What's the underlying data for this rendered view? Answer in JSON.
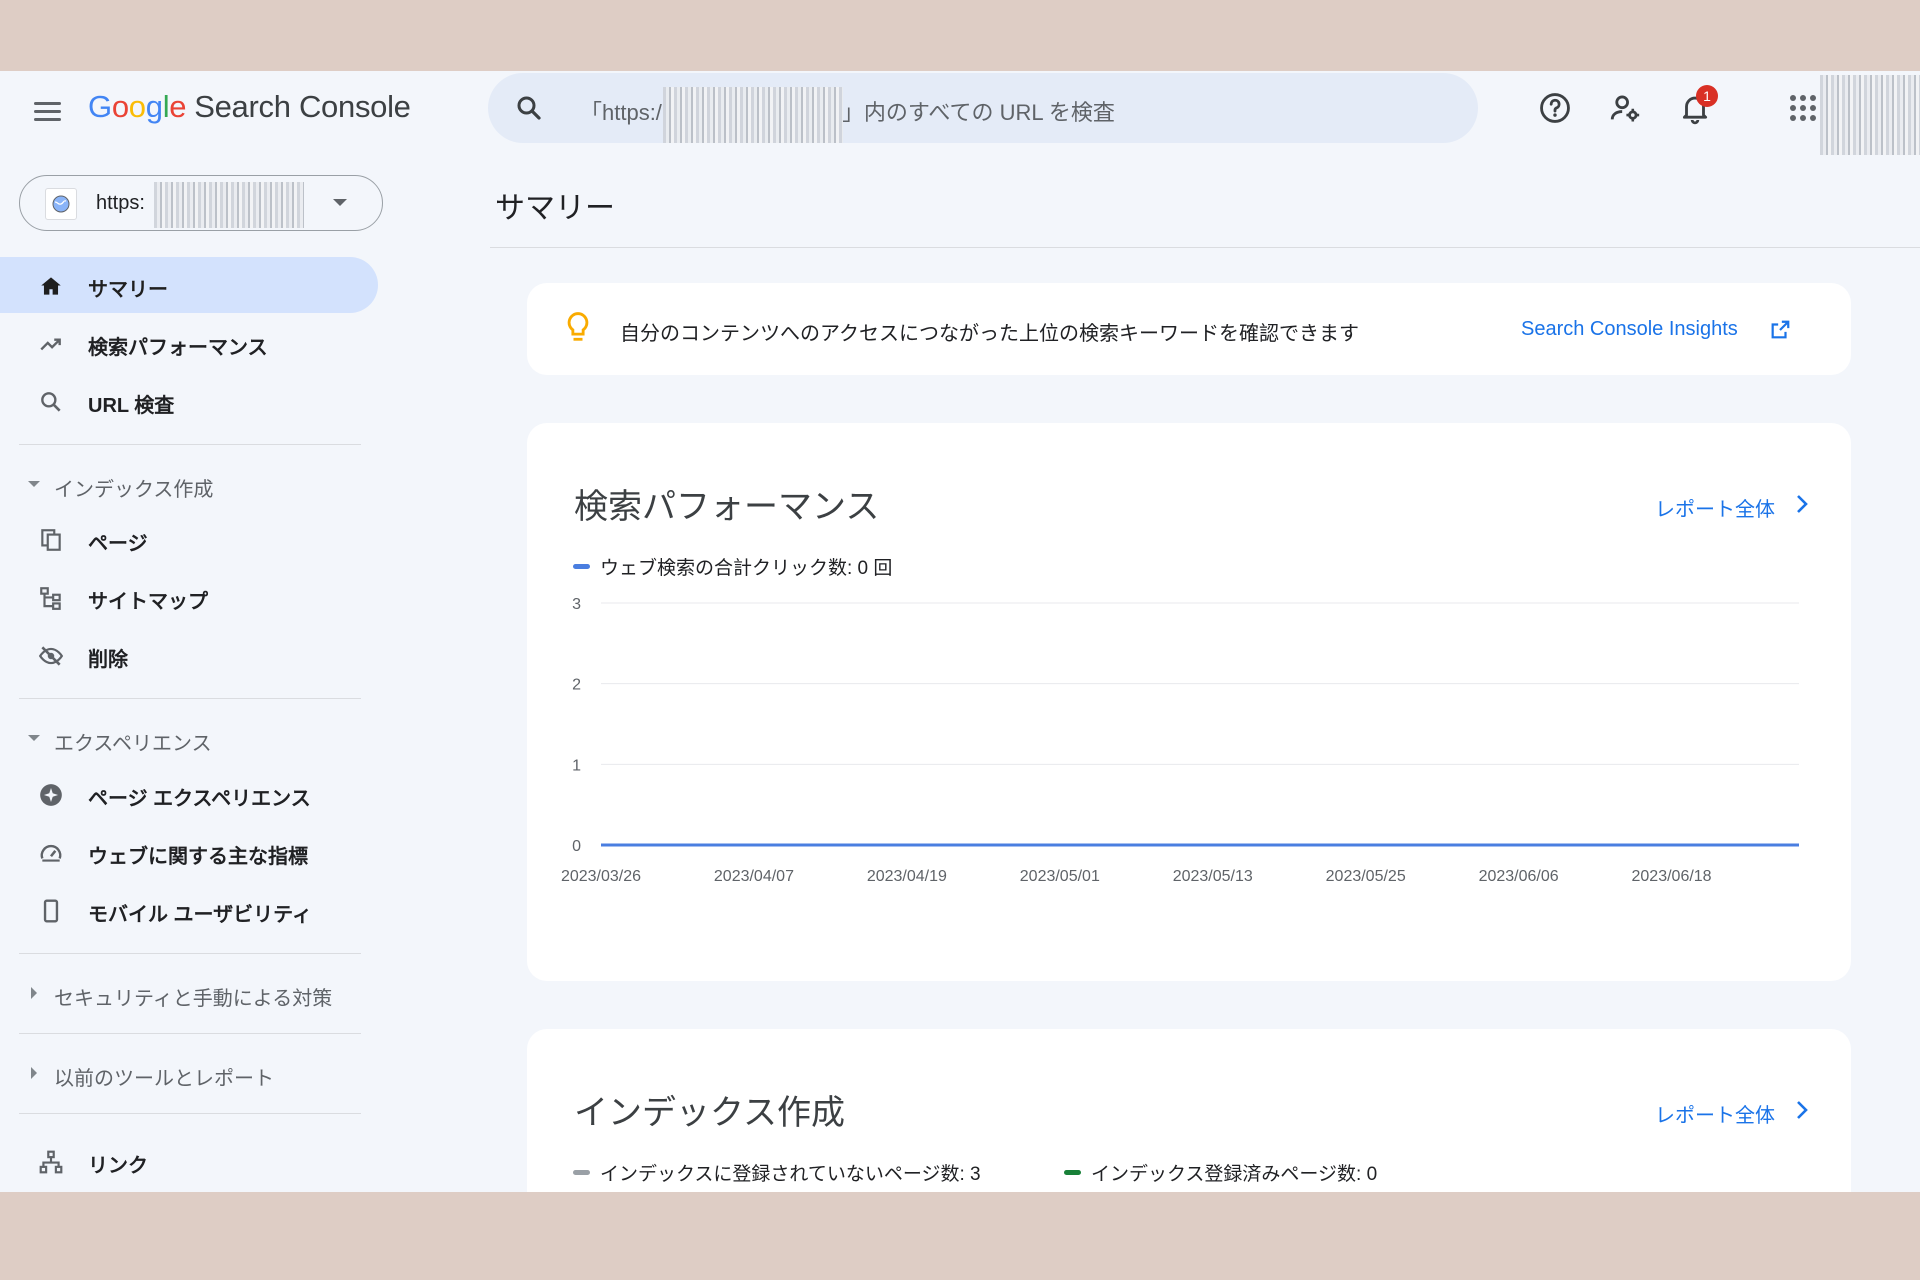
{
  "header": {
    "logo": [
      "G",
      "o",
      "o",
      "g",
      "l",
      "e"
    ],
    "product": "Search Console",
    "search_placeholder_prefix": "「https:/",
    "search_placeholder_suffix": "」内のすべての URL を検査",
    "notification_count": "1"
  },
  "sidebar": {
    "property": "https:",
    "items": [
      {
        "label": "サマリー",
        "icon": "home-icon"
      },
      {
        "label": "検索パフォーマンス",
        "icon": "trending-up-icon"
      },
      {
        "label": "URL 検査",
        "icon": "search-icon"
      }
    ],
    "section_index": "インデックス作成",
    "index_items": [
      {
        "label": "ページ",
        "icon": "pages-icon"
      },
      {
        "label": "サイトマップ",
        "icon": "sitemap-icon"
      },
      {
        "label": "削除",
        "icon": "visibility-off-icon"
      }
    ],
    "section_experience": "エクスペリエンス",
    "experience_items": [
      {
        "label": "ページ エクスペリエンス",
        "icon": "page-experience-icon"
      },
      {
        "label": "ウェブに関する主な指標",
        "icon": "speed-icon"
      },
      {
        "label": "モバイル ユーザビリティ",
        "icon": "mobile-icon"
      }
    ],
    "section_security": "セキュリティと手動による対策",
    "section_legacy": "以前のツールとレポート",
    "links_label": "リンク"
  },
  "main": {
    "page_title": "サマリー",
    "insight_text": "自分のコンテンツへのアクセスにつながった上位の検索キーワードを確認できます",
    "insight_link": "Search Console Insights",
    "performance": {
      "title": "検索パフォーマンス",
      "report_link": "レポート全体",
      "legend": "ウェブ検索の合計クリック数: 0 回"
    },
    "indexing": {
      "title": "インデックス作成",
      "report_link": "レポート全体",
      "legend_not_indexed": "インデックスに登録されていないページ数: 3",
      "legend_indexed": "インデックス登録済みページ数: 0"
    }
  },
  "colors": {
    "accent": "#1a73e8",
    "series_line": "#4a7ee0",
    "active_nav": "#d3e2fd",
    "not_indexed": "#9aa0a6",
    "indexed": "#188038"
  },
  "chart_data": {
    "type": "line",
    "title": "検索パフォーマンス",
    "x_tick_labels": [
      "2023/03/26",
      "2023/04/07",
      "2023/04/19",
      "2023/05/01",
      "2023/05/13",
      "2023/05/25",
      "2023/06/06",
      "2023/06/18"
    ],
    "y_ticks": [
      0,
      1,
      2,
      3
    ],
    "ylim": [
      0,
      3
    ],
    "xlim": [
      "2023/03/26",
      "2023/06/28"
    ],
    "series": [
      {
        "name": "ウェブ検索の合計クリック数",
        "x": [
          "2023/03/26",
          "2023/06/28"
        ],
        "values": [
          0,
          0
        ]
      }
    ],
    "grid": true
  }
}
